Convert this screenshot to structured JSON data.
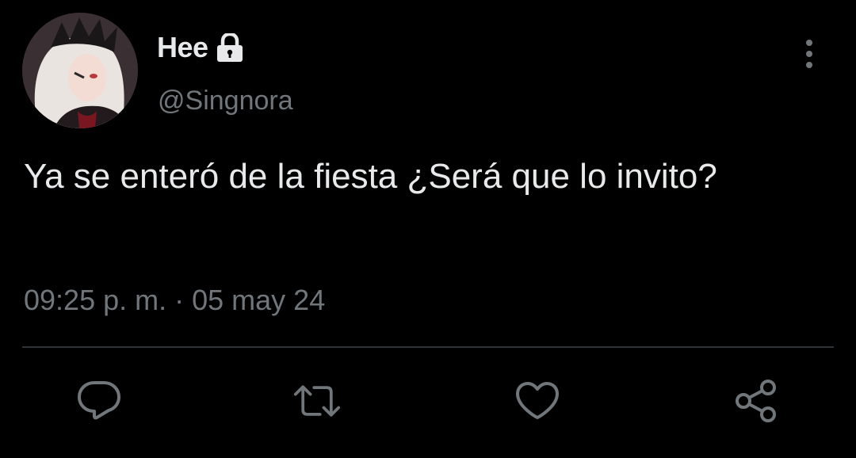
{
  "user": {
    "display_name": "Hee",
    "handle": "@Singnora",
    "protected": true,
    "avatar": "anime-character-avatar"
  },
  "tweet": {
    "text": "Ya se enteró de la fiesta ¿Será que lo invito?",
    "time": "09:25 p. m.",
    "separator": " · ",
    "date": "05 may 24"
  },
  "icons": {
    "more": "more-vertical-icon",
    "lock": "lock-icon",
    "reply": "reply-icon",
    "retweet": "retweet-icon",
    "like": "heart-icon",
    "share": "share-icon"
  },
  "colors": {
    "background": "#000000",
    "primary_text": "#e7e9ea",
    "secondary_text": "#71767b",
    "divider": "#2f3336",
    "icon": "#71767b"
  }
}
